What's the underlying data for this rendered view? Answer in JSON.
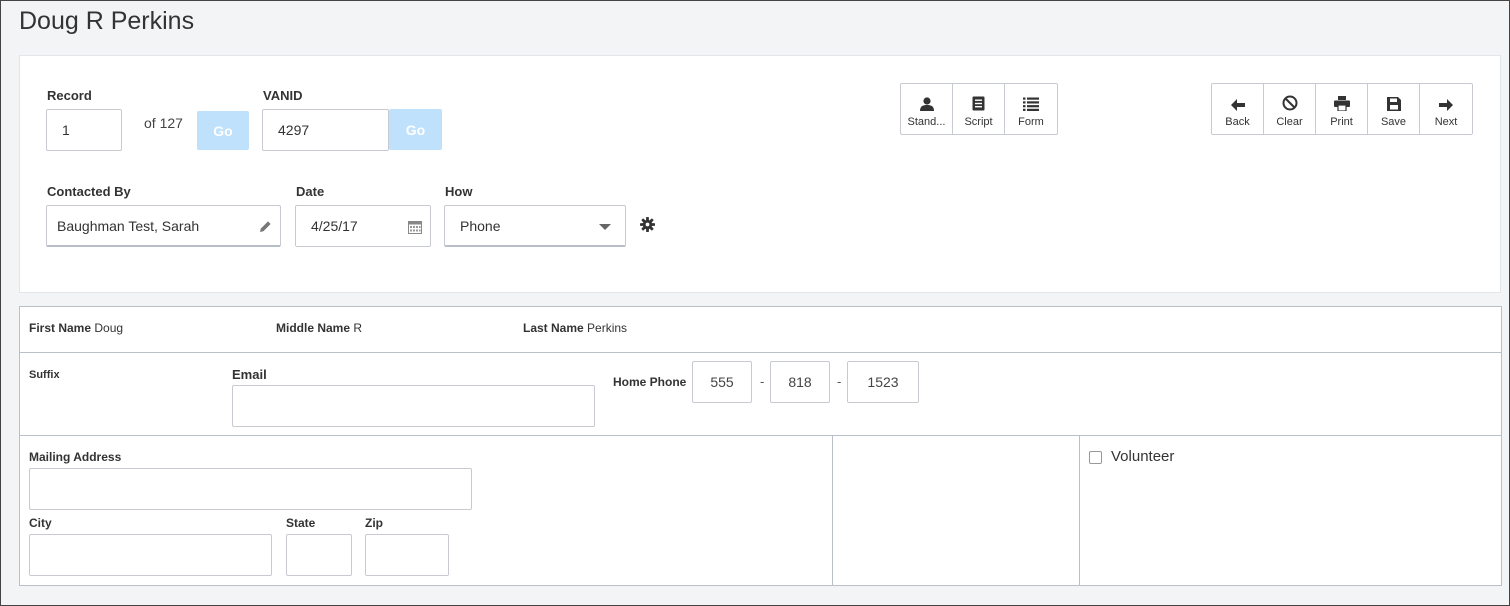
{
  "page": {
    "title": "Doug R Perkins"
  },
  "record": {
    "label": "Record",
    "value": "1",
    "of_text": "of 127",
    "go_label": "Go"
  },
  "vanid": {
    "label": "VANID",
    "value": "4297",
    "go_label": "Go"
  },
  "view_buttons": [
    {
      "label": "Stand...",
      "icon": "person-icon"
    },
    {
      "label": "Script",
      "icon": "script-icon"
    },
    {
      "label": "Form",
      "icon": "list-icon"
    }
  ],
  "nav_buttons": [
    {
      "label": "Back",
      "icon": "arrow-left-icon"
    },
    {
      "label": "Clear",
      "icon": "ban-icon"
    },
    {
      "label": "Print",
      "icon": "printer-icon"
    },
    {
      "label": "Save",
      "icon": "floppy-icon"
    },
    {
      "label": "Next",
      "icon": "arrow-right-icon"
    }
  ],
  "contact": {
    "contacted_by_label": "Contacted By",
    "contacted_by_value": "Baughman Test, Sarah",
    "date_label": "Date",
    "date_value": "4/25/17",
    "how_label": "How",
    "how_value": "Phone"
  },
  "person": {
    "first_name_label": "First Name",
    "first_name": "Doug",
    "middle_name_label": "Middle Name",
    "middle_name": "R",
    "last_name_label": "Last Name",
    "last_name": "Perkins",
    "suffix_label": "Suffix",
    "email_label": "Email",
    "email_value": "",
    "home_phone_label": "Home Phone",
    "phone_area": "555",
    "phone_prefix": "818",
    "phone_line": "1523",
    "phone_sep": "-"
  },
  "address": {
    "mailing_label": "Mailing Address",
    "city_label": "City",
    "state_label": "State",
    "zip_label": "Zip"
  },
  "volunteer": {
    "label": "Volunteer",
    "checked": false
  },
  "colors": {
    "go_button": "#bfe1fb",
    "border": "#c7cbd1",
    "panel_border": "#b9c0ca"
  }
}
